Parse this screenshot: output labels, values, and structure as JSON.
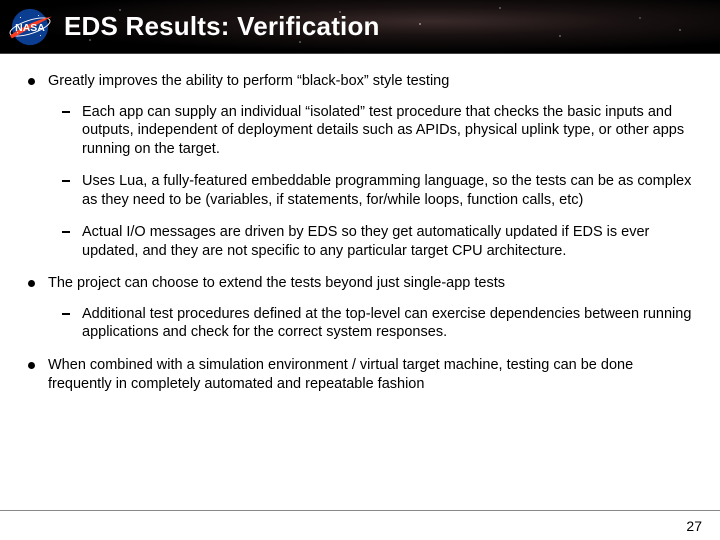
{
  "header": {
    "title": "EDS Results: Verification",
    "logo_alt": "NASA"
  },
  "bullets": [
    {
      "text": "Greatly improves the ability to perform “black-box” style testing",
      "sub": [
        "Each app can supply an individual “isolated” test procedure that checks the basic inputs and outputs, independent of deployment details such as APIDs, physical uplink type, or other apps running on the target.",
        "Uses Lua, a fully-featured embeddable programming language, so the tests can be as complex as they need to be (variables, if statements, for/while loops, function calls, etc)",
        "Actual I/O messages are driven by EDS so they get automatically updated if EDS is ever updated, and they are not specific to any particular target CPU architecture."
      ]
    },
    {
      "text": "The project can choose to extend the tests beyond just single-app tests",
      "sub": [
        "Additional test procedures defined at the top-level can exercise dependencies between running applications and check for the correct system responses."
      ]
    },
    {
      "text": "When combined with a simulation environment / virtual target machine, testing can be done frequently in completely automated and repeatable fashion",
      "sub": []
    }
  ],
  "footer": {
    "page_number": "27"
  }
}
